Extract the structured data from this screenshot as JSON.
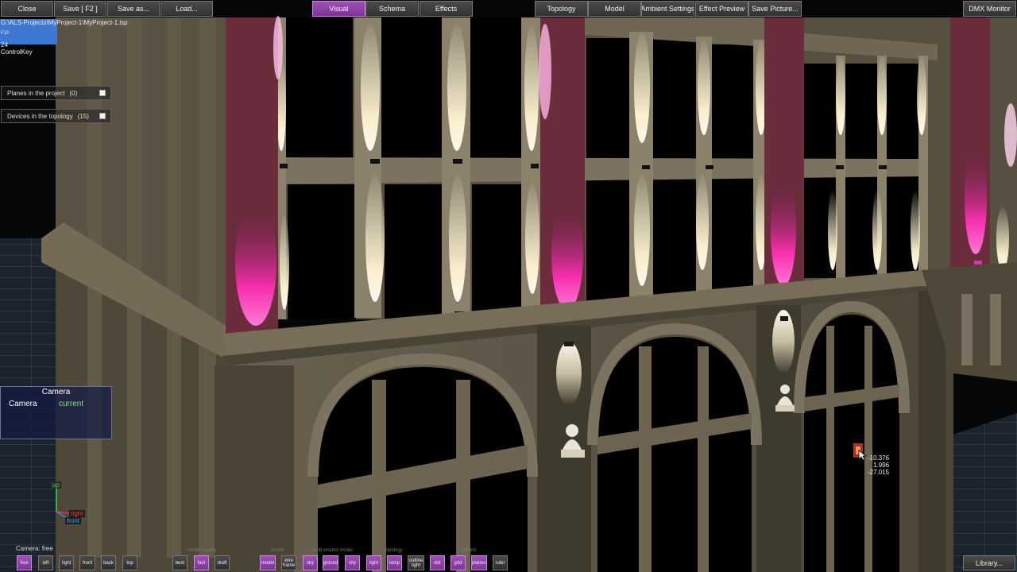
{
  "toolbar": {
    "file_buttons": [
      "Close",
      "Save [ F2 ]",
      "Save as...",
      "Load..."
    ],
    "view_tabs": [
      "Visual",
      "Schema",
      "Effects"
    ],
    "active_view": "Visual",
    "right_buttons": [
      "Topology",
      "Model",
      "Ambient Settings",
      "Effect Preview",
      "Save Picture..."
    ],
    "dmx_monitor": "DMX Monitor"
  },
  "info": {
    "project_path": "G:\\ALS-Projects\\MyProject-1\\MyProject-1.isp",
    "key_hint": "F10",
    "fps": "24",
    "control_key": "ControlKey"
  },
  "lists": {
    "planes": {
      "label": "Planes in the project",
      "count": "(0)"
    },
    "devices": {
      "label": "Devices in the topology",
      "count": "(15)"
    }
  },
  "camera_panel": {
    "title": "Camera",
    "label": "Camera",
    "value": "current"
  },
  "axes": {
    "up": "up",
    "right": "right",
    "front": "front"
  },
  "status": {
    "camera": "Camera: free"
  },
  "cursor_coords": [
    "-10.376",
    "1.996",
    "-27.015"
  ],
  "bottom_bar": {
    "camera_buttons": [
      "free",
      "left",
      "right",
      "front",
      "back",
      "top"
    ],
    "render_quality": {
      "label": "render quality",
      "buttons": [
        "best",
        "fast",
        "draft"
      ],
      "active": "fast"
    },
    "model": {
      "label": "model",
      "buttons": [
        "model",
        "wire frame"
      ],
      "active": "model"
    },
    "world": {
      "label": "world around model",
      "buttons": [
        "sky",
        "ground",
        "city"
      ],
      "active": [
        "sky",
        "ground",
        "city"
      ]
    },
    "topology": {
      "label": "topology",
      "buttons": [
        "light",
        "lamp",
        "outline light"
      ],
      "active": [
        "light",
        "lamp"
      ]
    },
    "helpers": {
      "label": "helpers",
      "buttons": [
        "dot",
        "grid",
        "planes",
        "ruler"
      ],
      "active": [
        "dot",
        "grid",
        "planes"
      ]
    },
    "library": "Library..."
  },
  "colors": {
    "accent_active": "#9c4bb4",
    "info_bar": "#3d77d1",
    "facade": "#5b5444",
    "magenta_light": "#ff2fb4",
    "warm_light": "#fff4d2",
    "camera_value": "#86e08a"
  }
}
